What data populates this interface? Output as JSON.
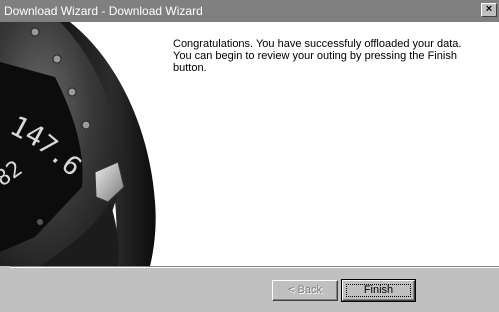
{
  "window": {
    "title": "Download Wizard - Download Wizard",
    "close_label": "×"
  },
  "message": {
    "line1": "Congratulations. You have successfuly offloaded your data.",
    "line2": "You can begin to review your outing by pressing the Finish button."
  },
  "side_image": {
    "display_digits": [
      "14",
      "7.6",
      "82"
    ],
    "colors": {
      "background": "#ffffff",
      "body": "#2a2a2a",
      "display": "#0c0c0c",
      "segments": "#d8d8d8"
    }
  },
  "buttons": {
    "back_label": "< Back",
    "finish_label": "Finish",
    "back_enabled": false
  },
  "colors": {
    "titlebar": "#808080",
    "dialog": "#c0c0c0",
    "content": "#ffffff"
  }
}
